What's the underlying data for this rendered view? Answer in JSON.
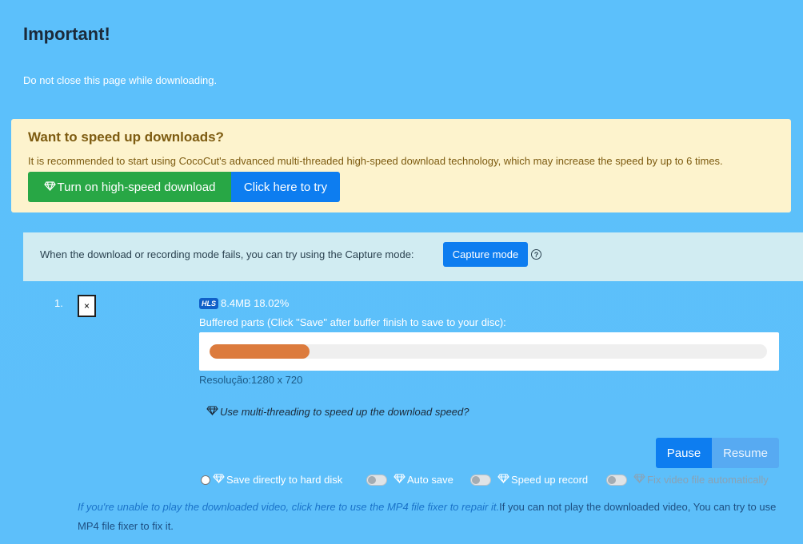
{
  "header": {
    "title": "Important!",
    "subtitle": "Do not close this page while downloading."
  },
  "promo": {
    "title": "Want to speed up downloads?",
    "text": "It is recommended to start using CocoCut's advanced multi-threaded high-speed download technology, which may increase the speed by up to 6 times.",
    "turn_on_label": "Turn on high-speed download",
    "try_label": "Click here to try"
  },
  "capture": {
    "text": "When the download or recording mode fails, you can try using the Capture mode:",
    "button_label": "Capture mode",
    "help_symbol": "?"
  },
  "download_item": {
    "index": "1.",
    "close_symbol": "×",
    "badge": "HLS",
    "size_info": "8.4MB 18.02%",
    "buffer_label": "Buffered parts (Click \"Save\" after buffer finish to save to your disc):",
    "buffer_progress": 0.18,
    "resolution": "Resolução:1280 x 720",
    "multithread_hint": "Use multi-threading to speed up the download speed?",
    "pause_label": "Pause",
    "resume_label": "Resume"
  },
  "options": {
    "save_to_disk": "Save directly to hard disk",
    "auto_save": "Auto save",
    "speed_up_record": "Speed up record",
    "fix_video": "Fix video file automatically"
  },
  "footer": {
    "link_text": "If you're unable to play the downloaded video, click here to use the MP4 file fixer to repair it.",
    "plain_text": "If you can not play the downloaded video, You can try to use MP4 file fixer to fix it."
  },
  "colors": {
    "background": "#5ec4fb",
    "promo_bg": "#fdf3cd",
    "green": "#28a745",
    "blue": "#0d7df0",
    "progress": "#dc7b3d",
    "capture_bg": "#d1ecf2"
  },
  "icons": {
    "gem": "gem-icon",
    "help": "help-icon",
    "close": "close-icon"
  }
}
